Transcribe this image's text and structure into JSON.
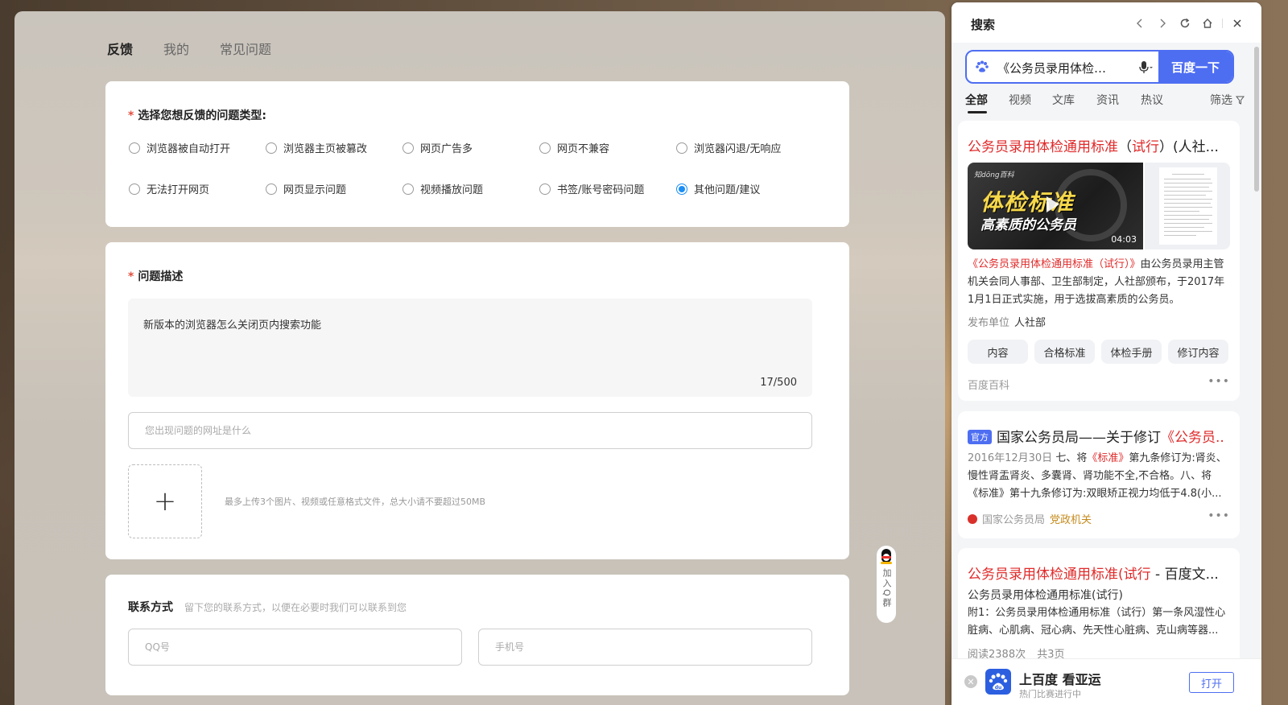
{
  "feedback": {
    "tabs": [
      "反馈",
      "我的",
      "常见问题"
    ],
    "issue_type": {
      "required_mark": "*",
      "label": "选择您想反馈的问题类型:",
      "options": [
        "浏览器被自动打开",
        "浏览器主页被篡改",
        "网页广告多",
        "网页不兼容",
        "浏览器闪退/无响应",
        "无法打开网页",
        "网页显示问题",
        "视频播放问题",
        "书签/账号密码问题",
        "其他问题/建议"
      ],
      "selected": "其他问题/建议"
    },
    "description": {
      "required_mark": "*",
      "label": "问题描述",
      "value": "新版本的浏览器怎么关闭页内搜索功能",
      "char_count": "17/500",
      "url_placeholder": "您出现问题的网址是什么",
      "upload_hint": "最多上传3个图片、视频或任意格式文件，总大小请不要超过50MB"
    },
    "contact": {
      "label": "联系方式",
      "sub": "留下您的联系方式，以便在必要时我们可以联系到您",
      "qq_placeholder": "QQ号",
      "phone_placeholder": "手机号"
    },
    "qq_float": "加入Q群"
  },
  "search_panel": {
    "title": "搜索",
    "query": "《公务员录用体检…",
    "search_button": "百度一下",
    "tabs": [
      "全部",
      "视频",
      "文库",
      "资讯",
      "热议"
    ],
    "filter": "筛选",
    "results": [
      {
        "title_hl": "公务员录用体检通用标准",
        "title_mid": "（",
        "title_hl2": "试行",
        "title_rest": "）(人社...",
        "video_brand": "知dōng百科",
        "video_big": "体检标准",
        "video_small": "高素质的公务员",
        "video_duration": "04:03",
        "desc_hl": "《公务员录用体检通用标准（试行）》",
        "desc_rest": "由公务员录用主管机关会同人事部、卫生部制定，人社部颁布，于2017年1月1日正式实施，用于选拔高素质的公务员。",
        "meta_label": "发布单位",
        "meta_value": "人社部",
        "chips": [
          "内容",
          "合格标准",
          "体检手册",
          "修订内容"
        ],
        "source": "百度百科"
      },
      {
        "badge": "官方",
        "title_plain": "国家公务员局——关于修订",
        "title_hl": "《公务员...",
        "date": "2016年12月30日",
        "desc_a": "七、将",
        "desc_hl": "《标准》",
        "desc_b": "第九条修订为:肾炎、慢性肾盂肾炎、多囊肾、肾功能不全,不合格。八、将《标准》第十九条修订为:双眼矫正视力均低于4.8(小...",
        "source": "国家公务员局",
        "source_tag": "党政机关"
      },
      {
        "title_hl": "公务员录用体检通用标准(试行",
        "title_rest": " - 百度文...",
        "subtitle": "公务员录用体检通用标准(试行)",
        "desc": "附1：公务员录用体检通用标准（试行）第一条风湿性心脏病、心肌病、冠心病、先天性心脏病、克山病等器...",
        "meta_a": "阅读2388次",
        "meta_b": "共3页"
      }
    ],
    "bottom_banner": {
      "logo_text": "du",
      "title": "上百度 看亚运",
      "sub": "热门比赛进行中",
      "open": "打开"
    }
  }
}
